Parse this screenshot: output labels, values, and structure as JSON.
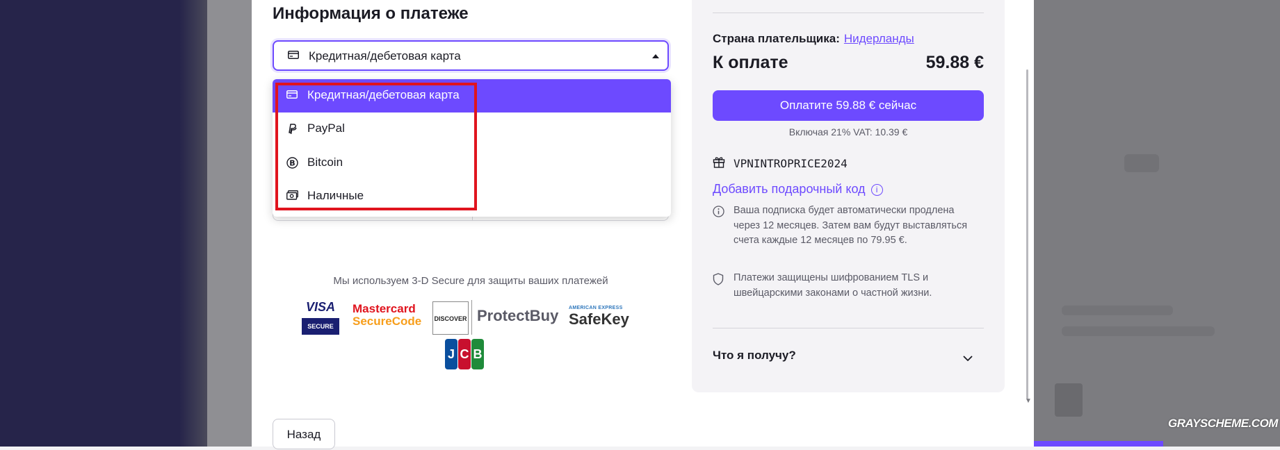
{
  "payment": {
    "title": "Информация о платеже",
    "method_select": {
      "value": "Кредитная/дебетовая карта",
      "icon": "credit-card-icon"
    },
    "options": [
      {
        "label": "Кредитная/дебетовая карта",
        "icon": "credit-card-icon",
        "selected": true
      },
      {
        "label": "PayPal",
        "icon": "paypal-icon",
        "selected": false
      },
      {
        "label": "Bitcoin",
        "icon": "bitcoin-icon",
        "selected": false
      },
      {
        "label": "Наличные",
        "icon": "cash-icon",
        "selected": false
      }
    ],
    "secure_note": "Мы используем 3-D Secure для защиты ваших платежей",
    "logos": {
      "visa_top": "VISA",
      "visa_bottom": "SECURE",
      "mastercard_l1": "Mastercard",
      "mastercard_l2": "SecureCode",
      "discover": "DISCOVER",
      "protectbuy_a": "Protect",
      "protectbuy_b": "Buy",
      "amex": "AMERICAN EXPRESS",
      "safekey": "SafeKey",
      "jcb": [
        "J",
        "C",
        "B"
      ]
    },
    "back_label": "Назад"
  },
  "summary": {
    "country_label": "Страна плательщика:",
    "country_value": "Нидерланды",
    "to_pay_label": "К оплате",
    "amount": "59.88 €",
    "pay_button": "Оплатите 59.88 € сейчас",
    "vat_note": "Включая 21% VAT: 10.39 €",
    "promo_code": "VPNINTROPRICE2024",
    "gift_link": "Добавить подарочный код",
    "renew_note": "Ваша подписка будет автоматически продлена через 12 месяцев. Затем вам будут выставляться счета каждые 12 месяцев по 79.95 €.",
    "security_note": "Платежи защищены шифрованием TLS и швейцарскими законами о частной жизни.",
    "what_get": "Что я получу?"
  },
  "watermark": "GRAYSCHEME.COM",
  "colors": {
    "accent": "#6d4aff",
    "highlight": "#e0141e",
    "text": "#1b1b24"
  }
}
